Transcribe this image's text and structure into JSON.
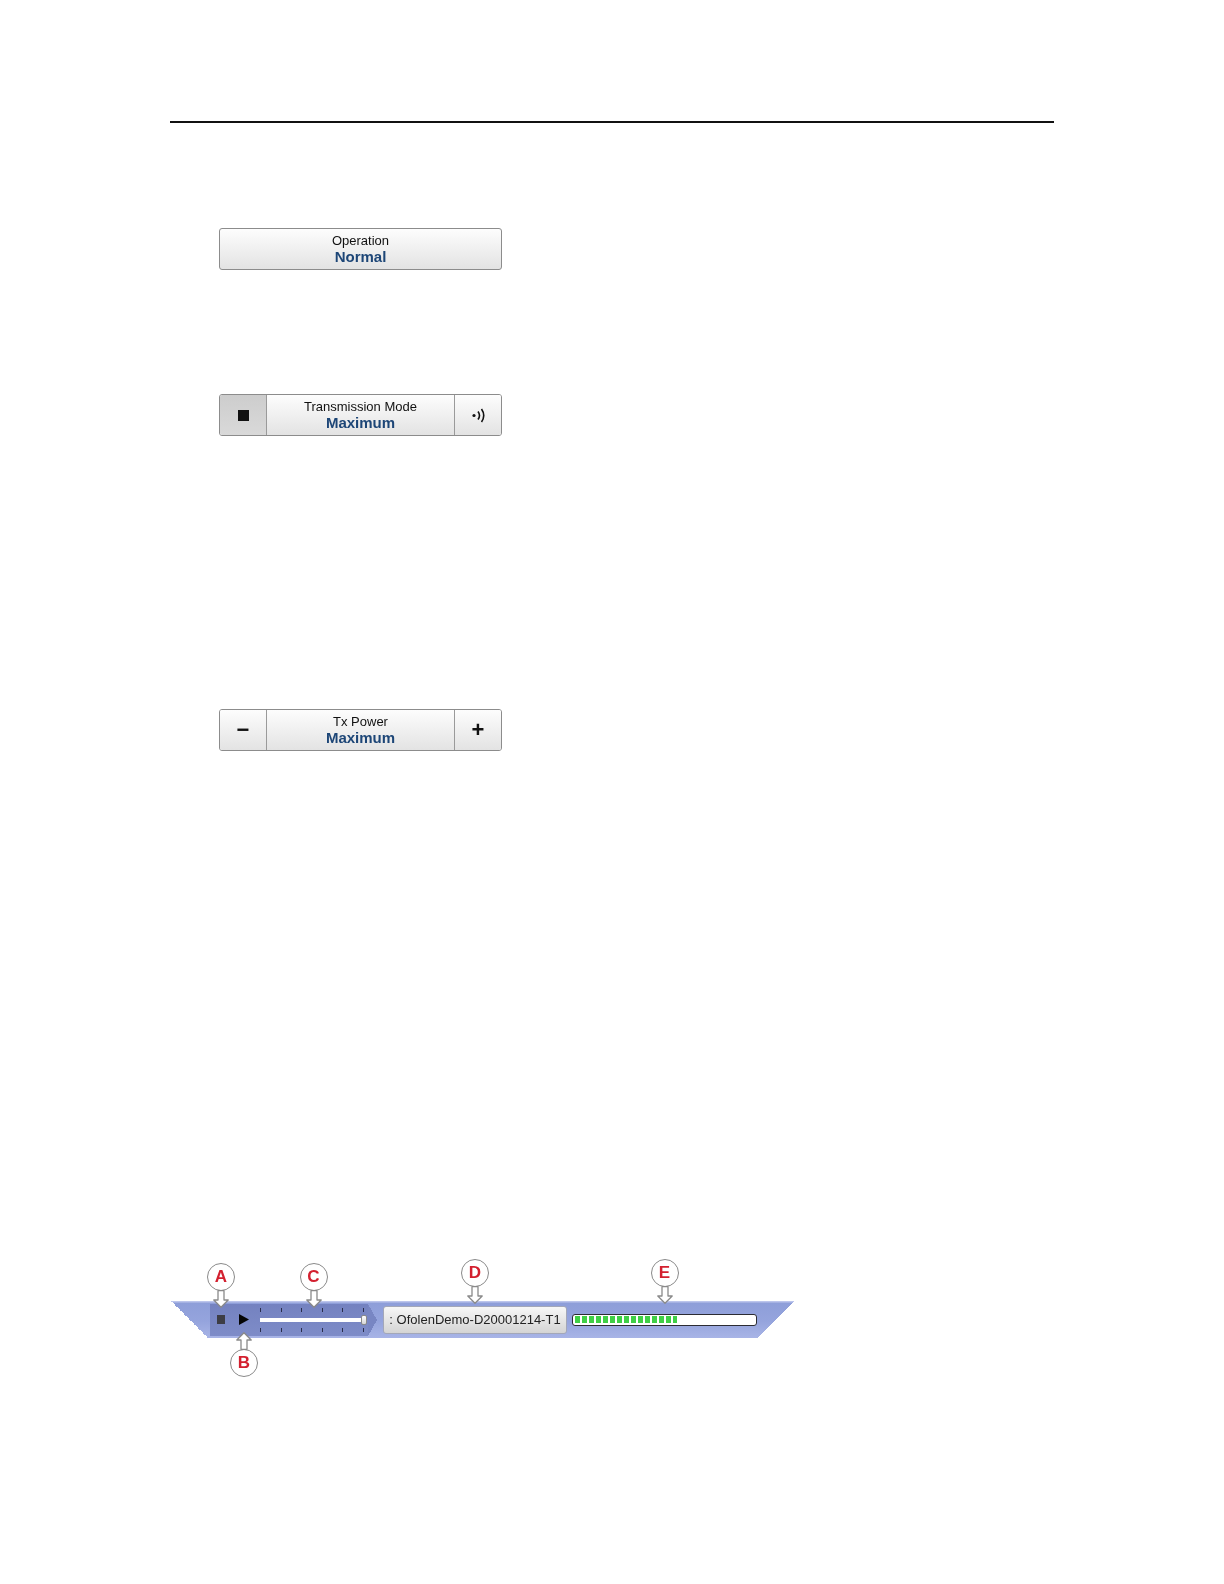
{
  "controls": [
    {
      "label": "Operation",
      "value": "Normal"
    },
    {
      "label": "Transmission Mode",
      "value": "Maximum",
      "left": {
        "kind": "stop",
        "pressed": true
      },
      "right": {
        "kind": "waves",
        "pressed": false
      }
    },
    {
      "label": "Tx Power",
      "value": "Maximum",
      "left": {
        "kind": "minus",
        "text": "−",
        "pressed": false
      },
      "right": {
        "kind": "plus",
        "text": "+",
        "pressed": false
      }
    }
  ],
  "replay_bar": {
    "items": [
      {
        "kind": "stop",
        "callout": {
          "label": "A",
          "kind": "above"
        }
      },
      {
        "kind": "play",
        "callout": {
          "label": "B",
          "kind": "below"
        }
      },
      {
        "kind": "slider",
        "level": 1,
        "callout": {
          "label": "C",
          "kind": "above"
        }
      },
      {
        "kind": "file",
        "label": ": OfolenDemo-D20001214-T1",
        "callout": {
          "label": "D",
          "kind": "above"
        }
      },
      {
        "kind": "progress",
        "level": 0.57,
        "callout": {
          "label": "E",
          "kind": "above"
        }
      }
    ]
  }
}
